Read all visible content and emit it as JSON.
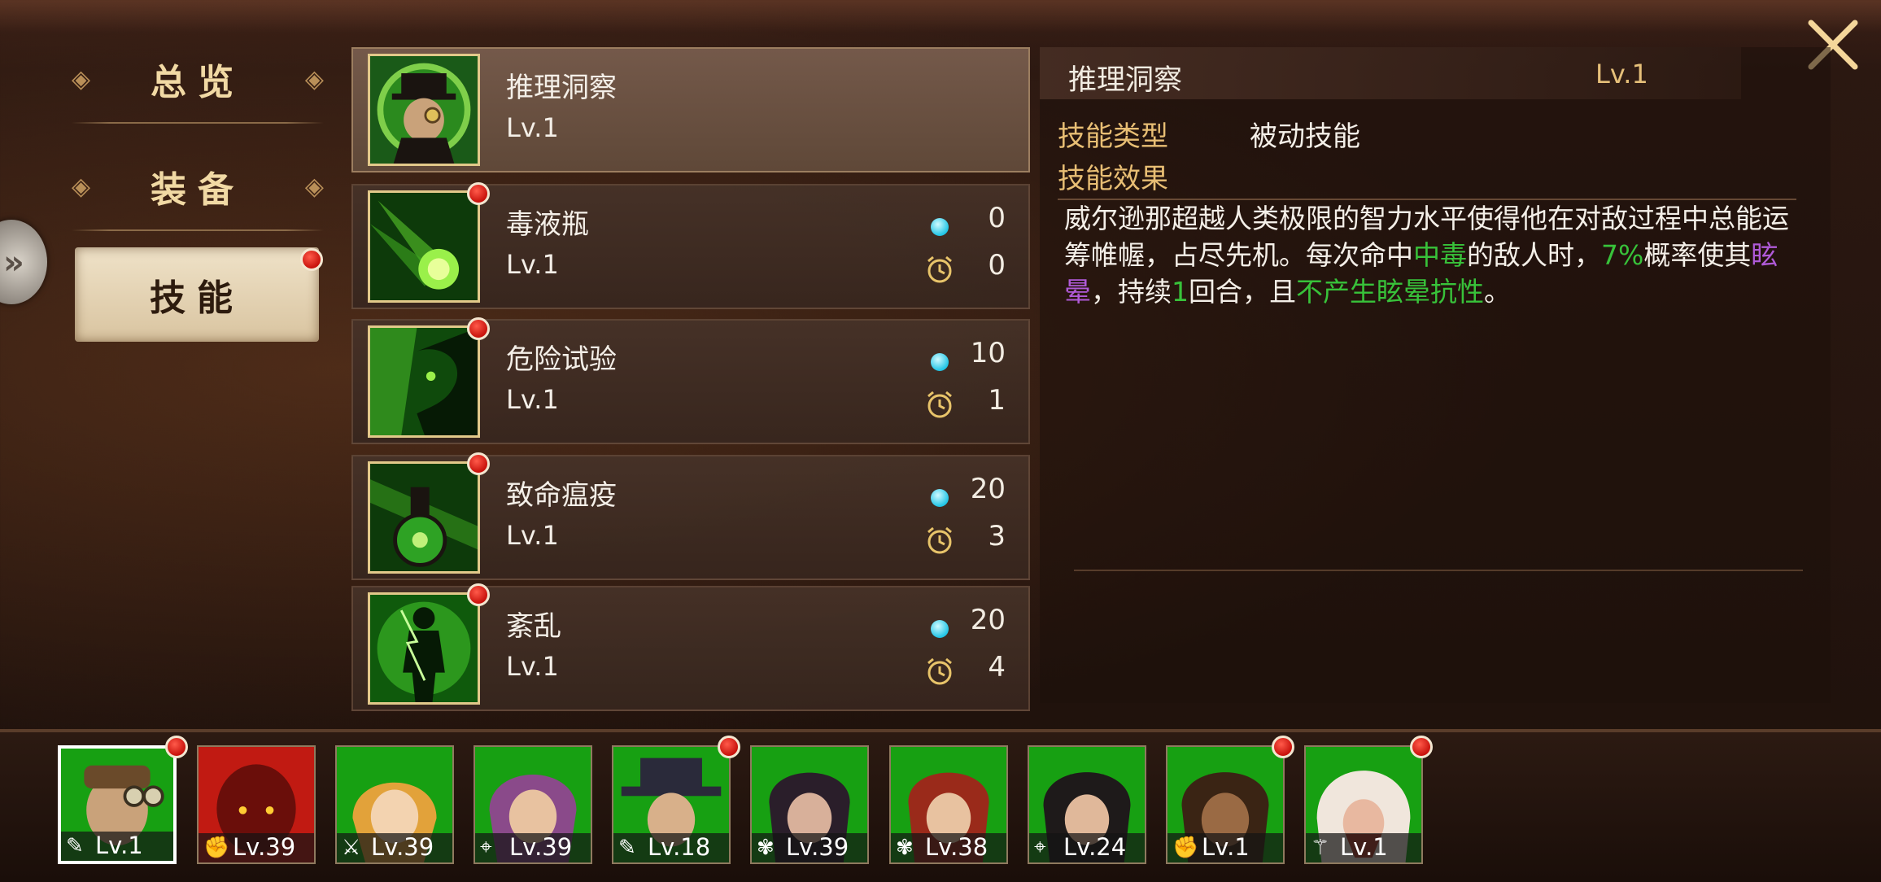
{
  "nav": {
    "tabs": [
      {
        "label": "总览"
      },
      {
        "label": "装备"
      },
      {
        "label": "技能"
      }
    ],
    "close_icon": "close-x-icon"
  },
  "skills": [
    {
      "name": "推理洞察",
      "level": "Lv.1",
      "cost": "",
      "cooldown": "",
      "icon": "detective-portrait",
      "selected": true
    },
    {
      "name": "毒液瓶",
      "level": "Lv.1",
      "cost": "0",
      "cooldown": "0",
      "icon": "poison-comet"
    },
    {
      "name": "危险试验",
      "level": "Lv.1",
      "cost": "10",
      "cooldown": "1",
      "icon": "toxic-silhouette"
    },
    {
      "name": "致命瘟疫",
      "level": "Lv.1",
      "cost": "20",
      "cooldown": "3",
      "icon": "poison-flask"
    },
    {
      "name": "紊乱",
      "level": "Lv.1",
      "cost": "20",
      "cooldown": "4",
      "icon": "electrified-figure"
    }
  ],
  "detail": {
    "title": "推理洞察",
    "level": "Lv.1",
    "type_key": "技能类型",
    "type_value": "被动技能",
    "effect_key": "技能效果",
    "desc": {
      "p1": "威尔逊那超越人类极限的智力水平使得他在对敌过程中总能运筹帷幄，占尽先机。每次命中",
      "poison": "中毒",
      "p2": "的敌人时，",
      "chance": "7%",
      "p3": "概率使其",
      "stun": "眩晕",
      "p4": "，持续",
      "turns": "1",
      "p5": "回合，且",
      "immune": "不产生眩晕抗性",
      "p6": "。"
    }
  },
  "colors": {
    "green_text": "#38c23a",
    "purple_text": "#b05ad8",
    "gold_label": "#e8be74",
    "badge_red": "#c8120c",
    "cost_cyan": "#22c5e6"
  },
  "heroes": [
    {
      "class_icon": "pen-icon",
      "level": "Lv.1",
      "selected": true,
      "badge": true,
      "bg": "green"
    },
    {
      "class_icon": "fist-icon",
      "level": "Lv.39",
      "bg": "red"
    },
    {
      "class_icon": "sword-icon",
      "level": "Lv.39",
      "bg": "green"
    },
    {
      "class_icon": "crosshair-icon",
      "level": "Lv.39",
      "bg": "green"
    },
    {
      "class_icon": "pen-icon",
      "level": "Lv.18",
      "badge": true,
      "bg": "green"
    },
    {
      "class_icon": "lotus-icon",
      "level": "Lv.39",
      "bg": "green"
    },
    {
      "class_icon": "lotus-icon",
      "level": "Lv.38",
      "bg": "green"
    },
    {
      "class_icon": "crosshair-icon",
      "level": "Lv.24",
      "bg": "green"
    },
    {
      "class_icon": "fist-icon",
      "level": "Lv.1",
      "badge": true,
      "bg": "green"
    },
    {
      "class_icon": "wand-icon",
      "level": "Lv.1",
      "badge": true,
      "bg": "green"
    }
  ]
}
